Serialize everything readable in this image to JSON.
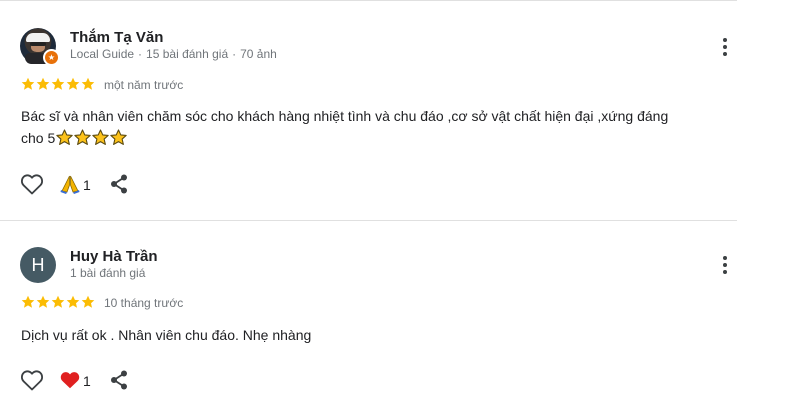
{
  "reviews": [
    {
      "author": "Thắm Tạ Văn",
      "meta": {
        "badge": "Local Guide",
        "reviews": "15 bài đánh giá",
        "photos": "70 ảnh",
        "separator": "·"
      },
      "rating": 5,
      "time": "một năm trước",
      "text_line1": "Bác sĩ và nhân viên chăm sóc cho khách hàng nhiệt tình và chu đáo ,cơ sở vật chất hiện đại ,xứng đáng",
      "text_line2": "cho 5",
      "trailing_emoji": "star-emoji",
      "trailing_emoji_count": 4,
      "reaction_icon": "folded-hands-emoji",
      "reaction_count": "1",
      "avatar": "profile-photo"
    },
    {
      "author": "Huy Hà Trần",
      "meta": {
        "reviews": "1 bài đánh giá"
      },
      "rating": 5,
      "time": "10 tháng trước",
      "text": "Dịch vụ rất ok . Nhân viên chu đáo. Nhẹ nhàng",
      "reaction_icon": "red-heart-emoji",
      "reaction_count": "1",
      "avatar_letter": "H",
      "avatar_color": "#455a64"
    }
  ],
  "colors": {
    "star": "#fbbc04",
    "meta_text": "#70757a",
    "divider": "#e0e0e0",
    "guide_badge": "#e8710a",
    "heart": "#e02020"
  },
  "icons": {
    "like": "heart-outline-icon",
    "share": "share-icon",
    "more": "more-vert-icon"
  }
}
